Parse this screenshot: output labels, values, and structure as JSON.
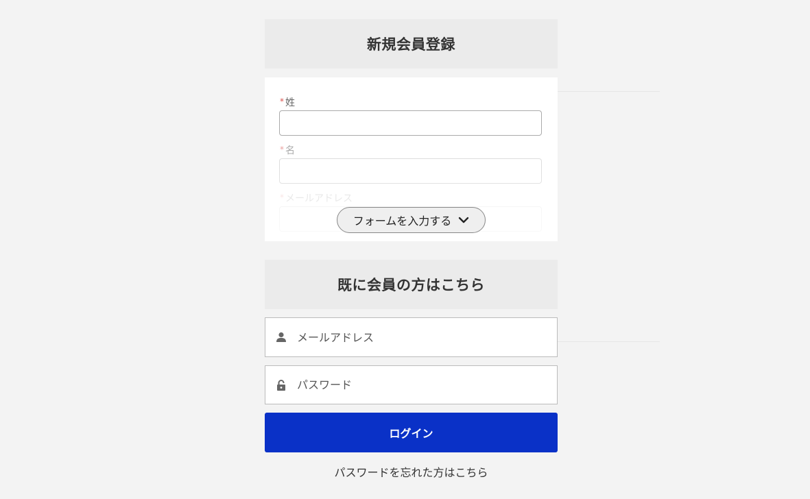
{
  "register": {
    "title": "新規会員登録",
    "required_mark": "*",
    "fields": [
      {
        "label": "姓",
        "value": ""
      },
      {
        "label": "名",
        "value": ""
      },
      {
        "label": "メールアドレス",
        "value": ""
      }
    ],
    "expand_button": "フォームを入力する",
    "expand_icon": "chevron-down-icon"
  },
  "login": {
    "title": "既に会員の方はこちら",
    "email_placeholder": "メールアドレス",
    "email_icon": "user-icon",
    "password_placeholder": "パスワード",
    "password_icon": "lock-icon",
    "submit_label": "ログイン",
    "forgot_link": "パスワードを忘れた方はこちら"
  },
  "colors": {
    "background": "#f3f3f3",
    "section_header_bg": "#ebebeb",
    "primary_button": "#0a31c7",
    "required": "#d9534f"
  }
}
